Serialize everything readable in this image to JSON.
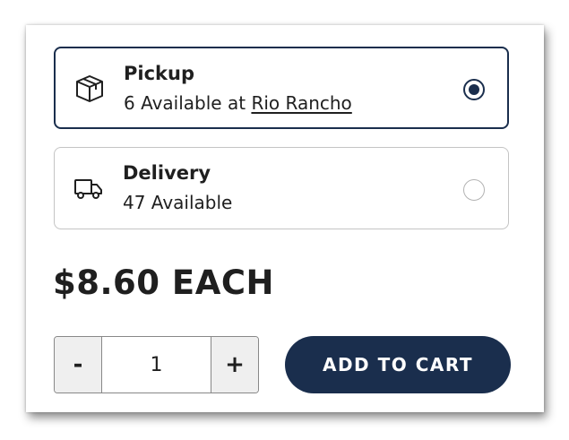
{
  "fulfillment": {
    "pickup": {
      "title": "Pickup",
      "availability_prefix": "6 Available at",
      "store_link": "Rio Rancho",
      "icon": "box-icon",
      "selected": true
    },
    "delivery": {
      "title": "Delivery",
      "availability": "47 Available",
      "icon": "truck-icon",
      "selected": false
    }
  },
  "price": {
    "label": "$8.60 EACH"
  },
  "quantity": {
    "decrement_label": "-",
    "value": "1",
    "increment_label": "+"
  },
  "cart": {
    "add_label": "ADD TO CART"
  },
  "colors": {
    "accent": "#1a2e4d",
    "border_selected": "#1a2e4d",
    "border_unselected": "#c4c4c4",
    "stepper_bg": "#efefef"
  }
}
